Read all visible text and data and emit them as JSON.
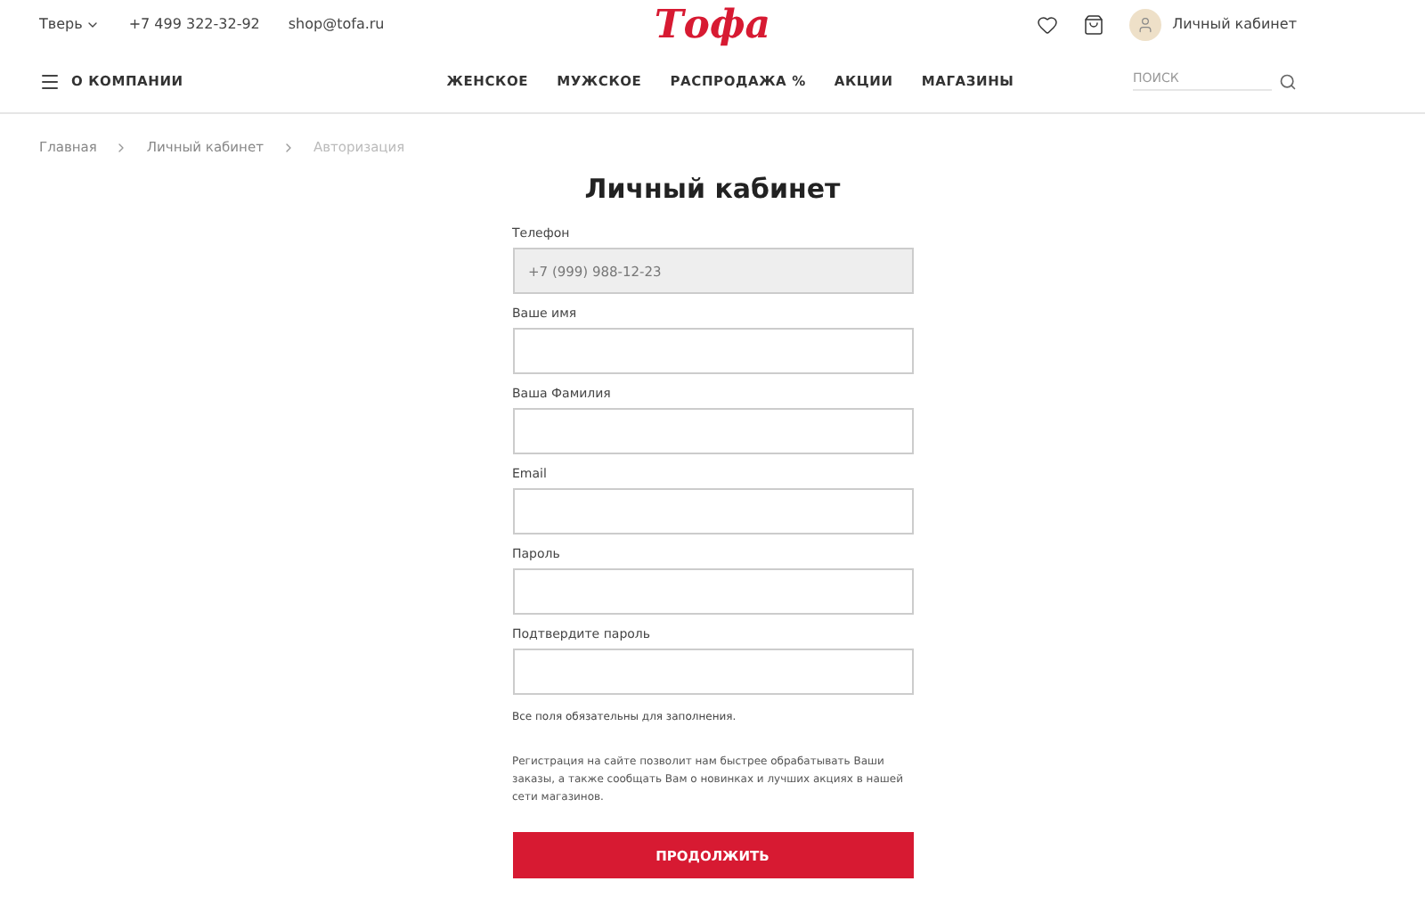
{
  "header": {
    "city": "Тверь",
    "phone": "+7 499 322-32-92",
    "email": "shop@tofa.ru",
    "logo": "Тофа",
    "account": "Личный кабинет"
  },
  "nav": {
    "menu": "О КОМПАНИИ",
    "items": [
      "ЖЕНСКОЕ",
      "МУЖСКОЕ",
      "РАСПРОДАЖА %",
      "АКЦИИ",
      "МАГАЗИНЫ"
    ],
    "search": {
      "placeholder": "ПОИСК"
    }
  },
  "breadcrumbs": [
    {
      "label": "Главная",
      "current": false
    },
    {
      "label": "Личный кабинет",
      "current": false
    },
    {
      "label": "Авторизация",
      "current": true
    }
  ],
  "form": {
    "title": "Личный кабинет",
    "fields": [
      {
        "label": "Телефон",
        "value": "+7 (999) 988-12-23",
        "disabled": true
      },
      {
        "label": "Ваше имя",
        "disabled": false
      },
      {
        "label": "Ваша Фамилия",
        "disabled": false
      },
      {
        "label": "Email",
        "disabled": false
      },
      {
        "label": "Пароль",
        "disabled": false
      },
      {
        "label": "Подтвердите пароль",
        "disabled": false
      }
    ],
    "note": "Все поля обязательны для заполнения.",
    "info": "Регистрация на сайте позволит нам быстрее обрабатывать Ваши заказы, а также сообщать Вам о новинках и лучших акциях в нашей сети магазинов.",
    "submit": "ПРОДОЛЖИТЬ"
  }
}
